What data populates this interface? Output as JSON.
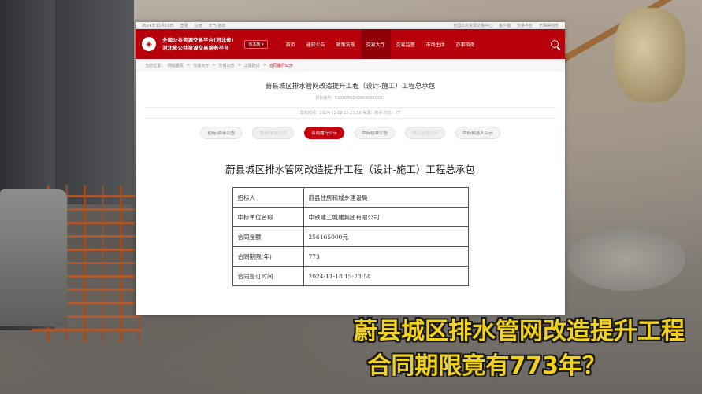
{
  "page": {
    "topbar": {
      "left_items": [
        "2024年11月19日",
        "登录",
        "注册",
        "天气·多云"
      ],
      "right_items": [
        "全国公共资源交易中心",
        "客户端",
        "交易平台",
        "无障碍浏览"
      ]
    },
    "header": {
      "site_name_line1": "全国公共资源交易平台(河北省)",
      "site_name_line2": "河北省公共资源交易服务平台",
      "region": "省本级 ▾",
      "nav": [
        "首页",
        "通知公告",
        "政策法规",
        "交易大厅",
        "交易监督",
        "市场主体",
        "办事指南"
      ],
      "active_nav": "交易大厅"
    },
    "breadcrumb": {
      "label": "当前位置：",
      "items": [
        "网站首页",
        "交易大厅",
        "交易公告",
        "工程建设"
      ],
      "current": "合同履行公示"
    },
    "project": {
      "title": "蔚县城区排水管网改造提升工程（设计-施工）工程总承包",
      "code": "项目编号：E1307000000080810081",
      "meta": "发布时间：2024-11-18 15:23:58    来源：蔚县    浏览：77"
    },
    "tabs": [
      {
        "label": "招标/资审公告",
        "state": "normal"
      },
      {
        "label": "澄清/变更公告",
        "state": "disabled"
      },
      {
        "label": "合同履行公示",
        "state": "active"
      },
      {
        "label": "中标结果公告",
        "state": "normal"
      },
      {
        "label": "终止公告公示",
        "state": "disabled"
      },
      {
        "label": "中标候选人公示",
        "state": "normal"
      }
    ],
    "doc_title": "蔚县城区排水管网改造提升工程（设计-施工）工程总承包",
    "contract_table": [
      {
        "key": "招标人",
        "value": "蔚县住房和城乡建设局"
      },
      {
        "key": "中标单位名称",
        "value": "中铁建工城建集团有限公司"
      },
      {
        "key": "合同金额",
        "value": "256165000元"
      },
      {
        "key": "合同期限(年)",
        "value": "773"
      },
      {
        "key": "合同签订时间",
        "value": "2024-11-18  15:23:58"
      }
    ]
  },
  "caption": {
    "line1": "蔚县城区排水管网改造提升工程",
    "line2": "合同期限竟有773年？"
  },
  "colors": {
    "brand_red": "#b7000b",
    "caption_yellow": "#f3d21a"
  }
}
